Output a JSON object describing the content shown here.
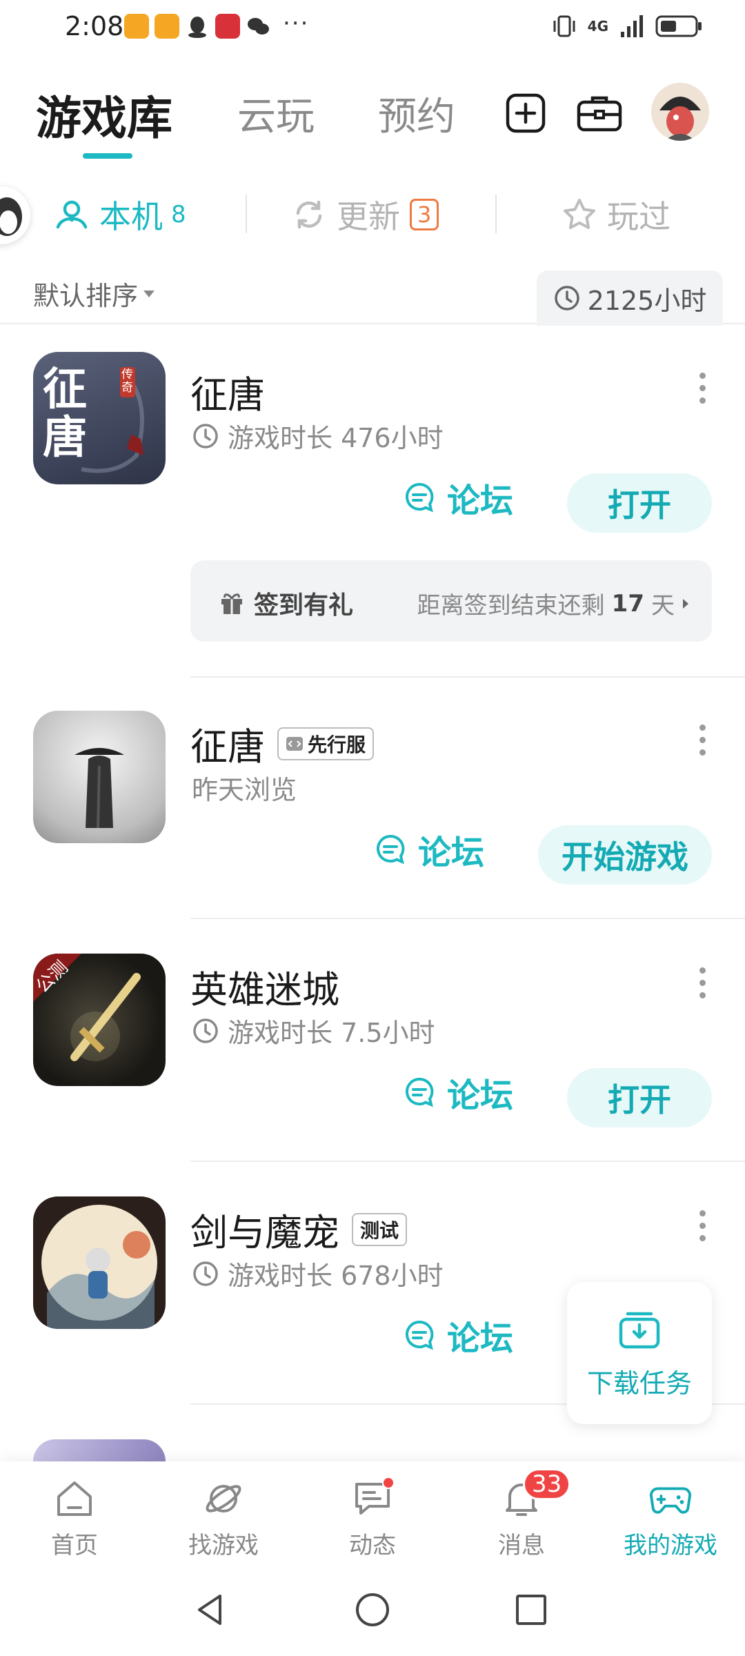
{
  "status_bar": {
    "time": "2:08",
    "more": "···",
    "network": "4G"
  },
  "top_tabs": [
    {
      "label": "游戏库",
      "active": true
    },
    {
      "label": "云玩",
      "active": false
    },
    {
      "label": "预约",
      "active": false
    }
  ],
  "filter_tabs": {
    "local": {
      "label": "本机",
      "count": "8"
    },
    "update": {
      "label": "更新",
      "count": "3"
    },
    "played": {
      "label": "玩过"
    }
  },
  "sort": {
    "label": "默认排序",
    "total_hours": "2125小时"
  },
  "games": [
    {
      "name": "征唐",
      "tag": "",
      "meta": "游戏时长 476小时",
      "has_clock": true,
      "forum": "论坛",
      "action": "打开",
      "icon_text": "征唐",
      "icon_sub": "传奇",
      "signin": {
        "label": "签到有礼",
        "prefix": "距离签到结束还剩",
        "days": "17",
        "suffix": "天"
      }
    },
    {
      "name": "征唐",
      "tag": "先行服",
      "meta": "昨天浏览",
      "has_clock": false,
      "forum": "论坛",
      "action": "开始游戏"
    },
    {
      "name": "英雄迷城",
      "tag": "",
      "meta": "游戏时长 7.5小时",
      "has_clock": true,
      "forum": "论坛",
      "action": "打开",
      "icon_ribbon": "公测"
    },
    {
      "name": "剑与魔宠",
      "tag": "测试",
      "meta": "游戏时长 678小时",
      "has_clock": true,
      "forum": "论坛",
      "action": ""
    }
  ],
  "download_task": "下载任务",
  "bottom_nav": [
    {
      "label": "首页",
      "icon": "home-icon"
    },
    {
      "label": "找游戏",
      "icon": "planet-icon"
    },
    {
      "label": "动态",
      "icon": "chat-icon"
    },
    {
      "label": "消息",
      "icon": "bell-icon",
      "badge": "33"
    },
    {
      "label": "我的游戏",
      "icon": "gamepad-icon",
      "active": true
    }
  ],
  "colors": {
    "accent": "#1cb9c2",
    "accent_bg": "#e7f8f8",
    "badge_red": "#f04444",
    "update_orange": "#ef7a3f"
  }
}
